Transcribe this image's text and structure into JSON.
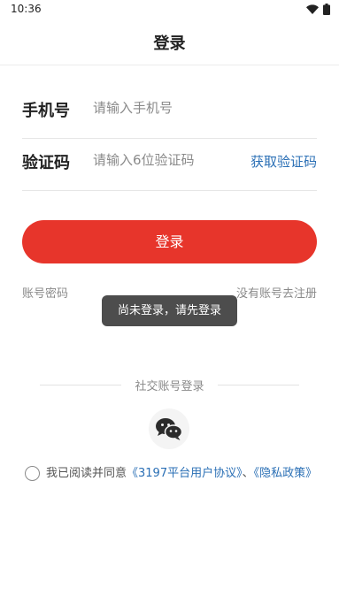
{
  "status_bar": {
    "time": "10:36",
    "icons": [
      "wifi-icon",
      "battery-icon"
    ]
  },
  "header": {
    "title": "登录"
  },
  "form": {
    "phone": {
      "label": "手机号",
      "value": "",
      "placeholder": "请输入手机号"
    },
    "code": {
      "label": "验证码",
      "value": "",
      "placeholder": "请输入6位验证码",
      "get_code": "获取验证码"
    }
  },
  "login_button": "登录",
  "links": {
    "password_login": "账号密码",
    "register": "没有账号去注册"
  },
  "toast": "尚未登录，请先登录",
  "social": {
    "divider_text": "社交账号登录",
    "icon": "wechat-icon"
  },
  "agreement": {
    "prefix": "我已阅读并同意",
    "user_agreement": "《3197平台用户协议》",
    "separator": "、",
    "privacy": "《隐私政策》"
  },
  "colors": {
    "primary": "#e7352b",
    "link": "#2a6fb5",
    "toast_bg": "#4d4d4d"
  }
}
